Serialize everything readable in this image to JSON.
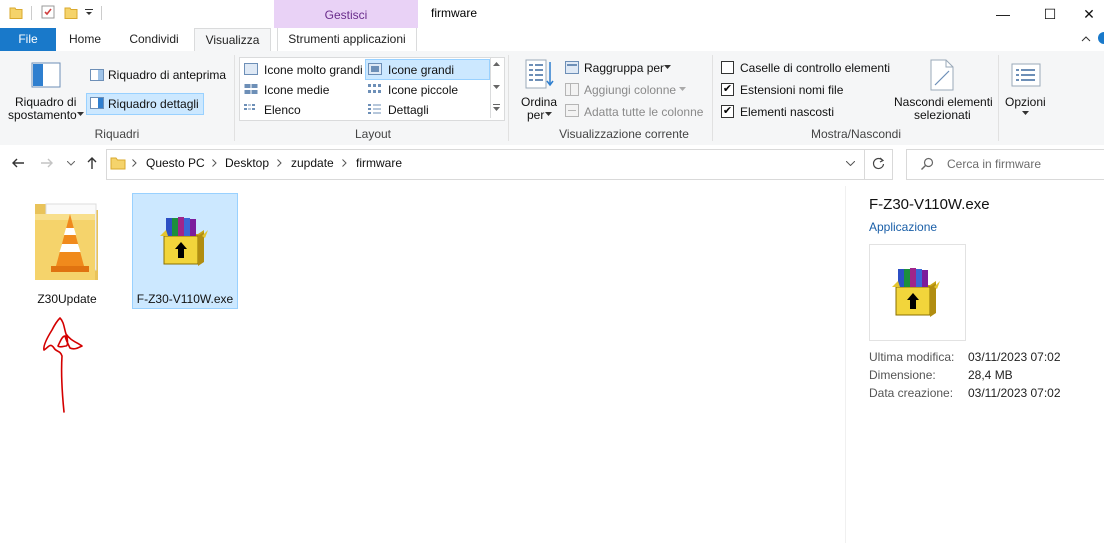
{
  "window": {
    "title": "firmware",
    "context_tab": "Gestisci",
    "controls": [
      "—",
      "☐",
      "✕"
    ]
  },
  "tabs": {
    "file": "File",
    "home": "Home",
    "condividi": "Condividi",
    "visualizza": "Visualizza",
    "strumenti": "Strumenti applicazioni"
  },
  "ribbon": {
    "riquadri": {
      "label": "Riquadri",
      "nav_pane_line1": "Riquadro di",
      "nav_pane_line2": "spostamento",
      "preview": "Riquadro di anteprima",
      "details": "Riquadro dettagli"
    },
    "layout": {
      "label": "Layout",
      "items": [
        "Icone molto grandi",
        "Icone grandi",
        "Icone medie",
        "Icone piccole",
        "Elenco",
        "Dettagli"
      ],
      "selected": "Icone grandi"
    },
    "view": {
      "label": "Visualizzazione corrente",
      "sort_line1": "Ordina",
      "sort_line2": "per",
      "group_by": "Raggruppa per",
      "add_columns": "Aggiungi colonne",
      "fit_columns": "Adatta tutte le colonne"
    },
    "show_hide": {
      "label": "Mostra/Nascondi",
      "checkbox_items": "Caselle di controllo elementi",
      "file_extensions": "Estensioni nomi file",
      "hidden_items": "Elementi nascosti",
      "checkbox_items_checked": false,
      "file_extensions_checked": true,
      "hidden_items_checked": true,
      "hide_selected_line1": "Nascondi elementi",
      "hide_selected_line2": "selezionati"
    },
    "options": {
      "label": "Opzioni"
    }
  },
  "address": {
    "breadcrumb": [
      "Questo PC",
      "Desktop",
      "zupdate",
      "firmware"
    ],
    "search_placeholder": "Cerca in firmware"
  },
  "files": [
    {
      "name": "Z30Update",
      "type": "folder-vlc"
    },
    {
      "name": "F-Z30-V110W.exe",
      "type": "winrar-exe",
      "selected": true
    }
  ],
  "details_pane": {
    "name": "F-Z30-V110W.exe",
    "type": "Applicazione",
    "meta": [
      {
        "key": "Ultima modifica:",
        "value": "03/11/2023 07:02"
      },
      {
        "key": "Dimensione:",
        "value": "28,4 MB"
      },
      {
        "key": "Data creazione:",
        "value": "03/11/2023 07:02"
      }
    ]
  },
  "colors": {
    "file_tab": "#1979ca",
    "selection": "#cce8ff",
    "selection_border": "#99d1ff",
    "context_band": "#e9d2f6",
    "annotation": "#d40000"
  }
}
